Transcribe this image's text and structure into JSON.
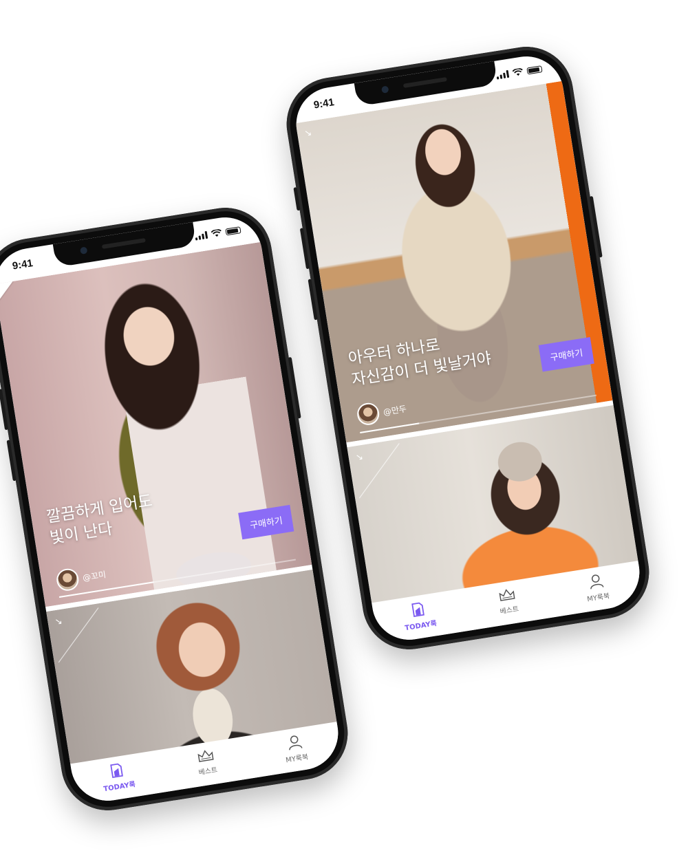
{
  "status_bar": {
    "time": "9:41"
  },
  "accent_color": "#8b6cf6",
  "icons": [
    "wifi-icon",
    "signal-icon",
    "battery-icon",
    "book-icon",
    "crown-icon",
    "person-icon",
    "arrow-icon"
  ],
  "phones": [
    {
      "feed": [
        {
          "caption": "깔끔하게 입어도\n빛이 난다",
          "buy_label": "구매하기",
          "author": "@꼬미",
          "progress": 0.4
        }
      ]
    },
    {
      "feed": [
        {
          "caption": "아우터 하나로\n자신감이 더 빛날거야",
          "buy_label": "구매하기",
          "author": "@만두",
          "progress": 0.25
        }
      ]
    }
  ],
  "tabbar": {
    "today": "TODAY룩",
    "best": "베스트",
    "my": "MY룩북"
  }
}
